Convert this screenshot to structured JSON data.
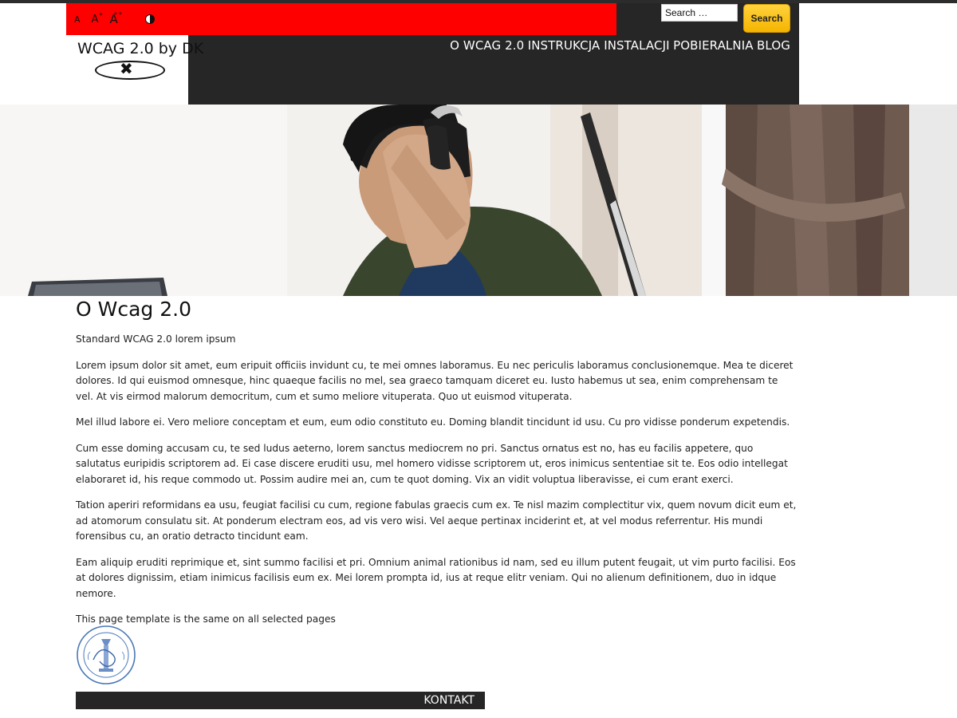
{
  "accessibility_bar": {
    "font_small": "A",
    "font_medium": "A",
    "font_medium_sup": "+",
    "font_large": "A",
    "font_large_sup": "++",
    "contrast_icon": "contrast-icon"
  },
  "search": {
    "placeholder": "Search …",
    "button_label": "Search"
  },
  "site": {
    "title": "WCAG 2.0 by DK",
    "logo_icon": "close-x-icon"
  },
  "nav": {
    "items": [
      {
        "label": "O WCAG 2.0"
      },
      {
        "label": "INSTRUKCJA INSTALACJI"
      },
      {
        "label": "POBIERALNIA"
      },
      {
        "label": "BLOG"
      }
    ]
  },
  "content": {
    "title": "O Wcag 2.0",
    "intro": "Standard WCAG 2.0 lorem ipsum",
    "paragraphs": [
      "Lorem ipsum dolor sit amet, eum eripuit officiis invidunt cu, te mei omnes laboramus. Eu nec periculis laboramus conclusionemque. Mea te diceret dolores. Id qui euismod omnesque, hinc quaeque facilis no mel, sea graeco tamquam diceret eu. Iusto habemus ut sea, enim comprehensam te vel. At vis eirmod malorum democritum, cum et sumo meliore vituperata. Quo ut euismod vituperata.",
      "Mel illud labore ei. Vero meliore conceptam et eum, eum odio constituto eu. Doming blandit tincidunt id usu. Cu pro vidisse ponderum expetendis.",
      "Cum esse doming accusam cu, te sed ludus aeterno, lorem sanctus mediocrem no pri. Sanctus ornatus est no, has eu facilis appetere, quo salutatus euripidis scriptorem ad. Ei case discere eruditi usu, mel homero vidisse scriptorem ut, eros inimicus sententiae sit te. Eos odio intellegat elaboraret id, his reque commodo ut. Possim audire mei an, cum te quot doming. Vix an vidit voluptua liberavisse, ei cum erant exerci.",
      "Tation aperiri reformidans ea usu, feugiat facilisi cu cum, regione fabulas graecis cum ex. Te nisl mazim complectitur vix, quem novum dicit eum et, ad atomorum consulatu sit. At ponderum electram eos, ad vis vero wisi. Vel aeque pertinax inciderint et, at vel modus referrentur. His mundi forensibus cu, an oratio detracto tincidunt eam.",
      "Eam aliquip eruditi reprimique et, sint summo facilisi et pri. Omnium animal rationibus id nam, sed eu illum putent feugait, ut vim purto facilisi. Eos at dolores dignissim, etiam inimicus facilisis eum ex. Mei lorem prompta id, ius at reque elitr veniam. Qui no alienum definitionem, duo in idque nemore."
    ],
    "footer_note": "This page template is the same on all selected pages"
  },
  "seal": {
    "icon": "university-seal-icon"
  },
  "footer": {
    "contact_label": "KONTAKT"
  },
  "colors": {
    "accessibility_bar": "#ff0000",
    "header_bg": "#262626",
    "search_button": "#f5b400"
  }
}
